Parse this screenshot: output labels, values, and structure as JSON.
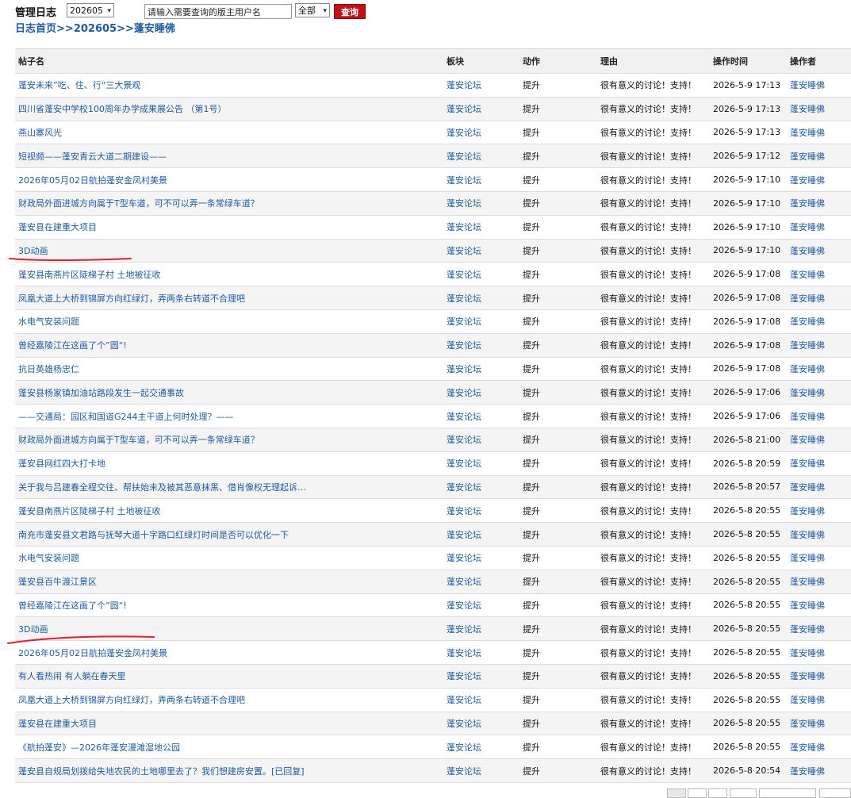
{
  "header": {
    "title": "管理日志",
    "month_select": "202605",
    "search_placeholder": "请输入需要查询的版主用户名",
    "scope_select": "全部",
    "query_button": "查询"
  },
  "breadcrumb": {
    "home": "日志首页",
    "sep1": ">>",
    "month": "202605",
    "sep2": ">>",
    "user": "蓬安睡佛"
  },
  "table": {
    "columns": [
      "帖子名",
      "板块",
      "动作",
      "理由",
      "操作时间",
      "操作者"
    ],
    "rows": [
      {
        "post": "蓬安未来”吃、住、行“三大景观",
        "board": "蓬安论坛",
        "action": "提升",
        "reason": "很有意义的讨论！支持！",
        "time": "2026-5-9 17:13",
        "operator": "蓬安睡佛"
      },
      {
        "post": "四川省蓬安中学校100周年办学成果展公告 （第1号）",
        "board": "蓬安论坛",
        "action": "提升",
        "reason": "很有意义的讨论！支持！",
        "time": "2026-5-9 17:13",
        "operator": "蓬安睡佛"
      },
      {
        "post": "燕山寨风光",
        "board": "蓬安论坛",
        "action": "提升",
        "reason": "很有意义的讨论！支持！",
        "time": "2026-5-9 17:13",
        "operator": "蓬安睡佛"
      },
      {
        "post": "短视频——蓬安青云大道二期建设——",
        "board": "蓬安论坛",
        "action": "提升",
        "reason": "很有意义的讨论！支持！",
        "time": "2026-5-9 17:12",
        "operator": "蓬安睡佛"
      },
      {
        "post": "2026年05月02日航拍蓬安金凤村美景",
        "board": "蓬安论坛",
        "action": "提升",
        "reason": "很有意义的讨论！支持！",
        "time": "2026-5-9 17:10",
        "operator": "蓬安睡佛"
      },
      {
        "post": "财政局外面进城方向属于T型车道，可不可以弄一条常绿车道？",
        "board": "蓬安论坛",
        "action": "提升",
        "reason": "很有意义的讨论！支持！",
        "time": "2026-5-9 17:10",
        "operator": "蓬安睡佛"
      },
      {
        "post": "蓬安县在建重大项目",
        "board": "蓬安论坛",
        "action": "提升",
        "reason": "很有意义的讨论！支持！",
        "time": "2026-5-9 17:10",
        "operator": "蓬安睡佛"
      },
      {
        "post": "3D动画",
        "board": "蓬安论坛",
        "action": "提升",
        "reason": "很有意义的讨论！支持！",
        "time": "2026-5-9 17:10",
        "operator": "蓬安睡佛"
      },
      {
        "post": "蓬安县南燕片区陡梯子村 土地被征收",
        "board": "蓬安论坛",
        "action": "提升",
        "reason": "很有意义的讨论！支持！",
        "time": "2026-5-9 17:08",
        "operator": "蓬安睡佛"
      },
      {
        "post": "凤凰大道上大桥到锦屏方向红绿灯，弄两条右转道不合理吧",
        "board": "蓬安论坛",
        "action": "提升",
        "reason": "很有意义的讨论！支持！",
        "time": "2026-5-9 17:08",
        "operator": "蓬安睡佛"
      },
      {
        "post": "水电气安装问题",
        "board": "蓬安论坛",
        "action": "提升",
        "reason": "很有意义的讨论！支持！",
        "time": "2026-5-9 17:08",
        "operator": "蓬安睡佛"
      },
      {
        "post": "曾经嘉陵江在这画了个”圆“!",
        "board": "蓬安论坛",
        "action": "提升",
        "reason": "很有意义的讨论！支持！",
        "time": "2026-5-9 17:08",
        "operator": "蓬安睡佛"
      },
      {
        "post": "抗日英雄杨忠仁",
        "board": "蓬安论坛",
        "action": "提升",
        "reason": "很有意义的讨论！支持！",
        "time": "2026-5-9 17:08",
        "operator": "蓬安睡佛"
      },
      {
        "post": "蓬安县杨家镇加油站路段发生一起交通事故",
        "board": "蓬安论坛",
        "action": "提升",
        "reason": "很有意义的讨论！支持！",
        "time": "2026-5-9 17:06",
        "operator": "蓬安睡佛"
      },
      {
        "post": "——交通局：园区和国道G244主干道上何时处理？——",
        "board": "蓬安论坛",
        "action": "提升",
        "reason": "很有意义的讨论！支持！",
        "time": "2026-5-9 17:06",
        "operator": "蓬安睡佛"
      },
      {
        "post": "财政局外面进城方向属于T型车道，可不可以弄一条常绿车道？",
        "board": "蓬安论坛",
        "action": "提升",
        "reason": "很有意义的讨论！支持！",
        "time": "2026-5-8 21:00",
        "operator": "蓬安睡佛"
      },
      {
        "post": "蓬安县网红四大打卡地",
        "board": "蓬安论坛",
        "action": "提升",
        "reason": "很有意义的讨论！支持！",
        "time": "2026-5-8 20:59",
        "operator": "蓬安睡佛"
      },
      {
        "post": "关于我与吕建春全程交往、帮扶始末及被其恶意抹黑、借肖像权无理起诉…",
        "board": "蓬安论坛",
        "action": "提升",
        "reason": "很有意义的讨论！支持！",
        "time": "2026-5-8 20:57",
        "operator": "蓬安睡佛"
      },
      {
        "post": "蓬安县南燕片区陡梯子村 土地被征收",
        "board": "蓬安论坛",
        "action": "提升",
        "reason": "很有意义的讨论！支持！",
        "time": "2026-5-8 20:55",
        "operator": "蓬安睡佛"
      },
      {
        "post": "南充市蓬安县文君路与抚琴大道十字路口红绿灯时间是否可以优化一下",
        "board": "蓬安论坛",
        "action": "提升",
        "reason": "很有意义的讨论！支持！",
        "time": "2026-5-8 20:55",
        "operator": "蓬安睡佛"
      },
      {
        "post": "水电气安装问题",
        "board": "蓬安论坛",
        "action": "提升",
        "reason": "很有意义的讨论！支持！",
        "time": "2026-5-8 20:55",
        "operator": "蓬安睡佛"
      },
      {
        "post": "蓬安县百牛渡江景区",
        "board": "蓬安论坛",
        "action": "提升",
        "reason": "很有意义的讨论！支持！",
        "time": "2026-5-8 20:55",
        "operator": "蓬安睡佛"
      },
      {
        "post": "曾经嘉陵江在这画了个”圆“!",
        "board": "蓬安论坛",
        "action": "提升",
        "reason": "很有意义的讨论！支持！",
        "time": "2026-5-8 20:55",
        "operator": "蓬安睡佛"
      },
      {
        "post": "3D动画",
        "board": "蓬安论坛",
        "action": "提升",
        "reason": "很有意义的讨论！支持！",
        "time": "2026-5-8 20:55",
        "operator": "蓬安睡佛"
      },
      {
        "post": "2026年05月02日航拍蓬安金凤村美景",
        "board": "蓬安论坛",
        "action": "提升",
        "reason": "很有意义的讨论！支持！",
        "time": "2026-5-8 20:55",
        "operator": "蓬安睡佛"
      },
      {
        "post": "有人看热闹 有人躺在春天里",
        "board": "蓬安论坛",
        "action": "提升",
        "reason": "很有意义的讨论！支持！",
        "time": "2026-5-8 20:55",
        "operator": "蓬安睡佛"
      },
      {
        "post": "凤凰大道上大桥到锦屏方向红绿灯，弄两条右转道不合理吧",
        "board": "蓬安论坛",
        "action": "提升",
        "reason": "很有意义的讨论！支持！",
        "time": "2026-5-8 20:55",
        "operator": "蓬安睡佛"
      },
      {
        "post": "蓬安县在建重大项目",
        "board": "蓬安论坛",
        "action": "提升",
        "reason": "很有意义的讨论！支持！",
        "time": "2026-5-8 20:55",
        "operator": "蓬安睡佛"
      },
      {
        "post": "《航拍蓬安》—2026年蓬安漫滩湿地公园",
        "board": "蓬安论坛",
        "action": "提升",
        "reason": "很有意义的讨论！支持！",
        "time": "2026-5-8 20:55",
        "operator": "蓬安睡佛"
      },
      {
        "post": "蓬安县自规局划拨给失地农民的土地哪里去了？我们想建房安置。[已回复]",
        "board": "蓬安论坛",
        "action": "提升",
        "reason": "很有意义的讨论！支持！",
        "time": "2026-5-8 20:54",
        "operator": "蓬安睡佛"
      }
    ]
  },
  "colors": {
    "link": "#1f5a9e",
    "query_button_bg": "#c0111a",
    "annotation_underline": "#e0202a",
    "row_alt_bg": "#f4f4f4",
    "header_bg": "#f1f1f1"
  }
}
